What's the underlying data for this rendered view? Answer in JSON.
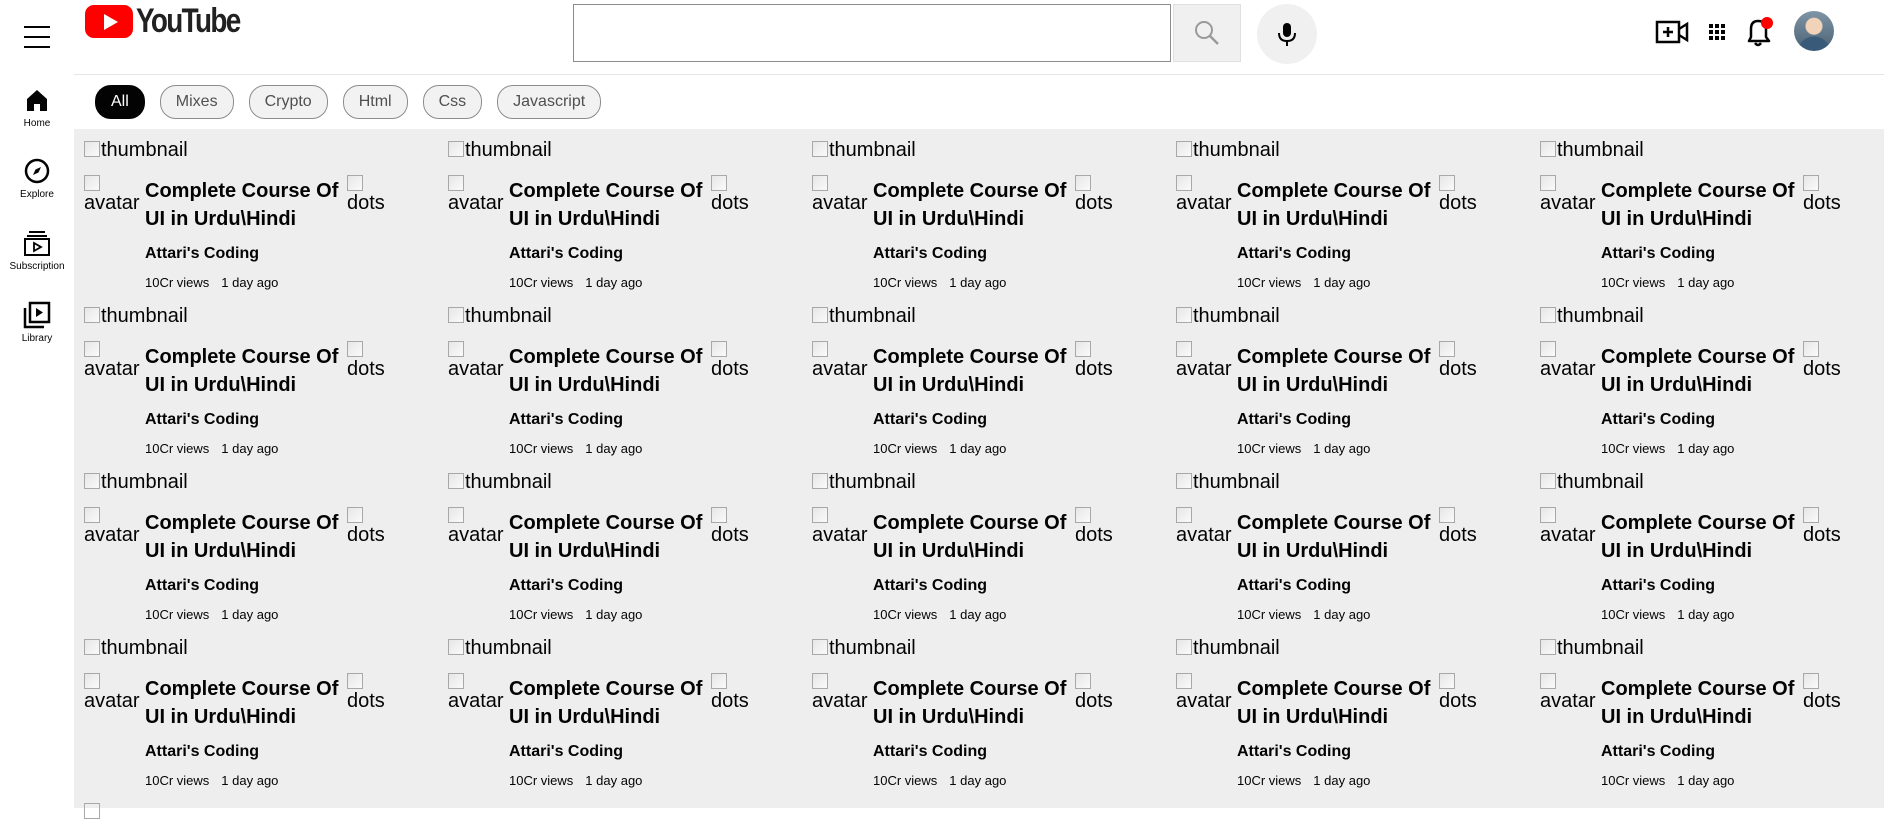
{
  "header": {
    "logo_text": "YouTube",
    "search_placeholder": "",
    "search_value": ""
  },
  "sidebar": {
    "items": [
      {
        "label": "Home",
        "icon": "home-icon"
      },
      {
        "label": "Explore",
        "icon": "compass-icon"
      },
      {
        "label": "Subscription",
        "icon": "subscriptions-icon"
      },
      {
        "label": "Library",
        "icon": "library-icon"
      }
    ]
  },
  "chips": [
    "All",
    "Mixes",
    "Crypto",
    "Html",
    "Css",
    "Javascript"
  ],
  "active_chip": "All",
  "video": {
    "thumbnail_alt": "thumbnail",
    "avatar_alt": "avatar",
    "dots_alt": "dots",
    "title": "Complete Course Of UI in Urdu\\Hindi",
    "channel": "Attari's Coding",
    "views": "10Cr views",
    "age": "1 day ago"
  },
  "grid": {
    "rows": 4,
    "columns": 5
  },
  "colors": {
    "brand_red": "#ff0000",
    "notification_dot": "#ff0000",
    "content_bg": "#efeeef",
    "active_chip_bg": "#030303"
  }
}
